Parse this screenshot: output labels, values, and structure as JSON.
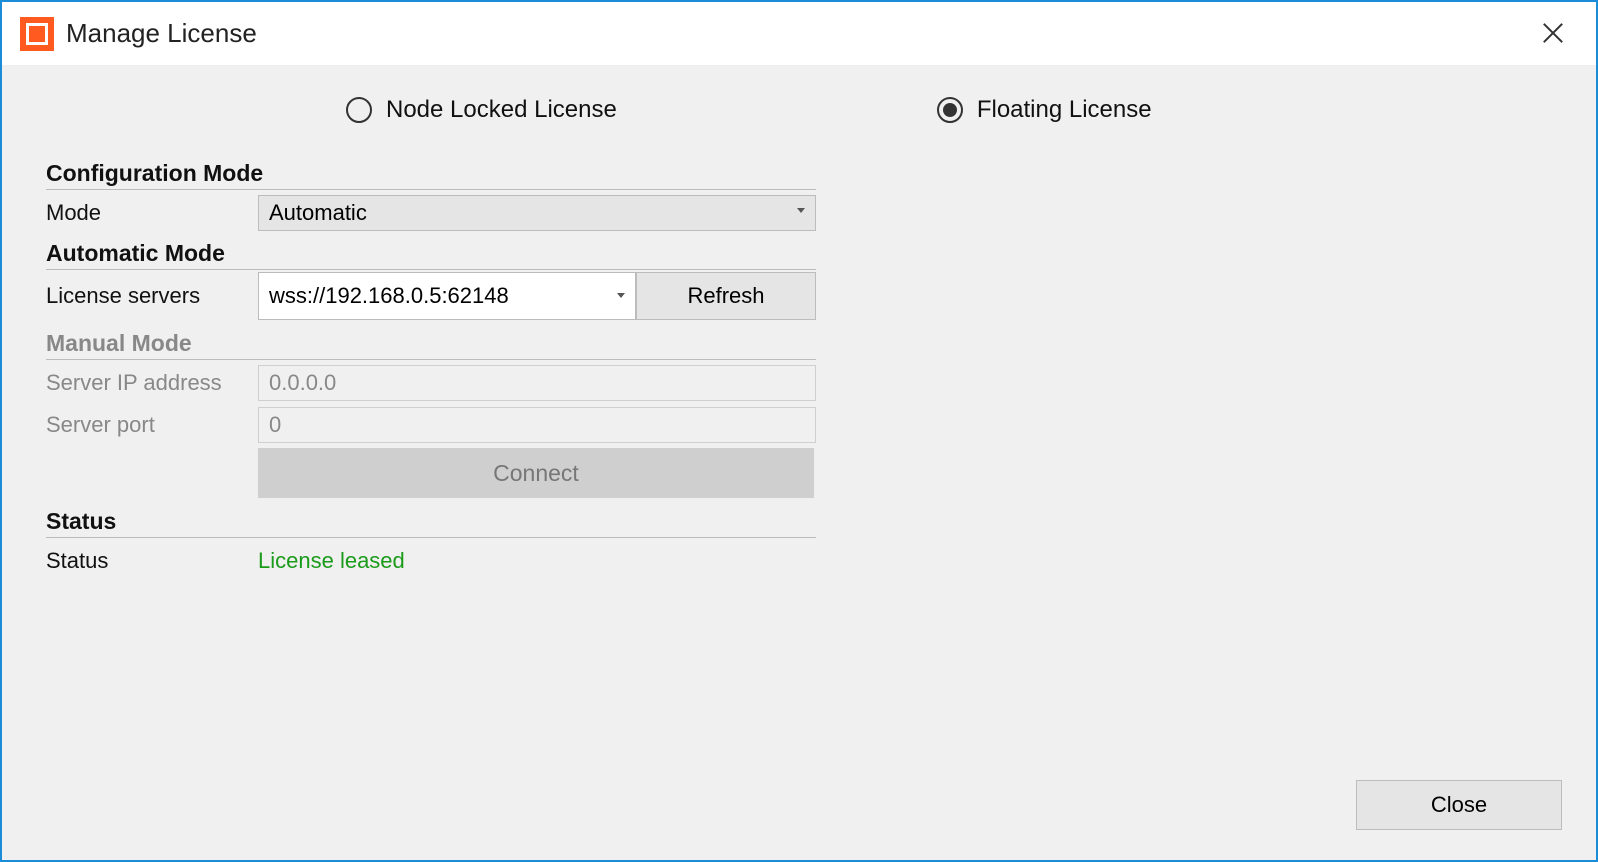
{
  "window": {
    "title": "Manage License"
  },
  "license_type": {
    "node_locked_label": "Node Locked License",
    "floating_label": "Floating License",
    "selected": "floating"
  },
  "sections": {
    "config_head": "Configuration Mode",
    "auto_head": "Automatic Mode",
    "manual_head": "Manual Mode",
    "status_head": "Status"
  },
  "config": {
    "mode_label": "Mode",
    "mode_value": "Automatic"
  },
  "auto": {
    "servers_label": "License servers",
    "server_value": "wss://192.168.0.5:62148",
    "refresh_label": "Refresh"
  },
  "manual": {
    "ip_label": "Server IP address",
    "ip_value": "0.0.0.0",
    "port_label": "Server port",
    "port_value": "0",
    "connect_label": "Connect"
  },
  "status": {
    "label": "Status",
    "value": "License leased"
  },
  "footer": {
    "close_label": "Close"
  }
}
